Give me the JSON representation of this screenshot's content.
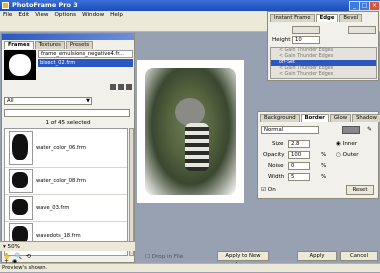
{
  "app": {
    "title": "PhotoFrame Pro 3"
  },
  "menu": [
    "File",
    "Edit",
    "View",
    "Options",
    "Window",
    "Help"
  ],
  "left_panel": {
    "tabs": [
      "Frames",
      "Textures",
      "Presets"
    ],
    "file_items": [
      "frame_emulsions_negative4.fr...",
      "bisect_02.frm"
    ],
    "category": "All",
    "selection_info": "1 of 45 selected",
    "thumbnails": [
      {
        "label": "water_color_06.frm"
      },
      {
        "label": "water_color_08.frm"
      },
      {
        "label": "wave_03.frm"
      },
      {
        "label": "wavedots_18.frm"
      }
    ],
    "zoom": "50%"
  },
  "top_panel": {
    "tabs": [
      "Instant Frame",
      "Edge",
      "Bevel"
    ],
    "height_label": "Height",
    "height_value": "10",
    "layers": [
      "< Gain Thunder Edges",
      "< Gain Thunder Edges",
      "off-Set",
      "< Gain Thunder Edges",
      "< Gain Thunder Edges"
    ]
  },
  "border_panel": {
    "tabs": [
      "Background",
      "Border",
      "Glow",
      "Shadow"
    ],
    "blend_mode": "Normal",
    "size_label": "Size",
    "size_value": "2.8",
    "inner_label": "Inner",
    "opacity_label": "Opacity",
    "opacity_value": "100",
    "outer_label": "Outer",
    "noise_label": "Noise",
    "noise_value": "0",
    "width_label": "Width",
    "width_value": "5",
    "on_label": "On",
    "reset_label": "Reset"
  },
  "bottom": {
    "show_with_label": "Drop in File",
    "apply_new_layer": "Apply to New Layer",
    "apply": "Apply",
    "cancel": "Cancel"
  },
  "status": "Preview's shown.",
  "colors": {
    "titlebar": "#1c4db8",
    "panel": "#f1f0ea",
    "workspace": "#97a1b2",
    "highlight": "#2a58c0"
  }
}
